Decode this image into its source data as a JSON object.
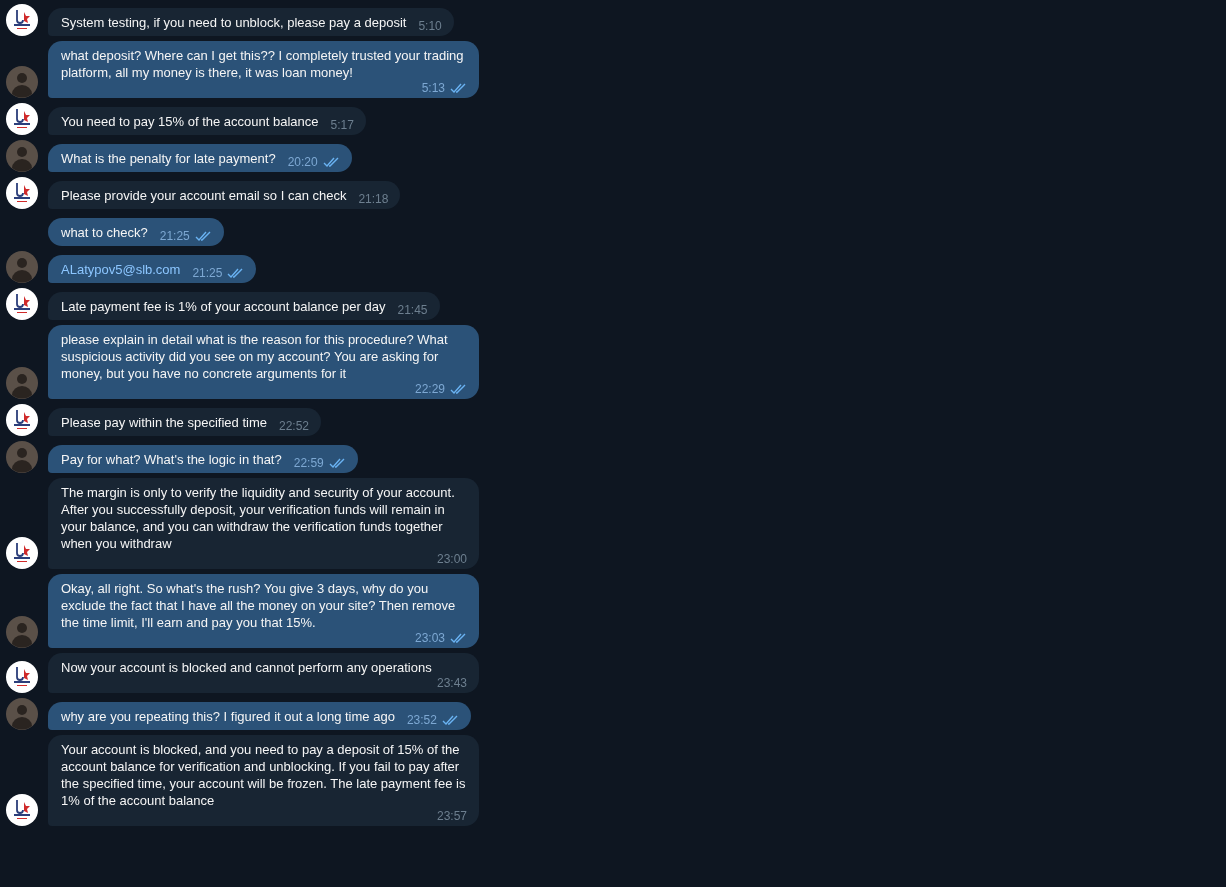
{
  "messages": [
    {
      "kind": "incoming",
      "text": "System testing, if you need to unblock, please pay a deposit",
      "time": "5:10",
      "avatar": true
    },
    {
      "kind": "outgoing",
      "text": "what deposit?  Where can I get this??  I completely trusted your trading platform, all my money is there, it was loan money!",
      "time": "5:13",
      "avatar": true,
      "read": true
    },
    {
      "kind": "incoming",
      "text": "You need to pay 15% of the account balance",
      "time": "5:17",
      "avatar": true
    },
    {
      "kind": "outgoing",
      "text": "What is the penalty for late payment?",
      "time": "20:20",
      "avatar": true,
      "read": true
    },
    {
      "kind": "incoming",
      "text": "Please provide your account email so I can check",
      "time": "21:18",
      "avatar": true
    },
    {
      "kind": "outgoing",
      "text": "what to check?",
      "time": "21:25",
      "avatar": false,
      "read": true
    },
    {
      "kind": "outgoing",
      "text": "ALatypov5@slb.com",
      "time": "21:25",
      "avatar": true,
      "read": true,
      "link": true
    },
    {
      "kind": "incoming",
      "text": "Late payment fee is 1% of your account balance per day",
      "time": "21:45",
      "avatar": true
    },
    {
      "kind": "outgoing",
      "text": "please explain in detail what is the reason for this procedure? What suspicious activity did you see on my account? You are asking for money, but you have no concrete arguments for it",
      "time": "22:29",
      "avatar": true,
      "read": true
    },
    {
      "kind": "incoming",
      "text": "Please pay within the specified time",
      "time": "22:52",
      "avatar": true
    },
    {
      "kind": "outgoing",
      "text": "Pay for what? What's the logic in that?",
      "time": "22:59",
      "avatar": true,
      "read": true
    },
    {
      "kind": "incoming",
      "text": "The margin is only to verify the liquidity and security of your account. After you successfully deposit, your verification funds will remain in your balance, and you can withdraw the verification funds together when you withdraw",
      "time": "23:00",
      "avatar": true
    },
    {
      "kind": "outgoing",
      "text": "Okay, all right. So what's the rush? You give 3 days, why do you exclude the fact that I have all the money on your site? Then remove the time limit, I'll earn and pay you that 15%.",
      "time": "23:03",
      "avatar": true,
      "read": true
    },
    {
      "kind": "incoming",
      "text": "Now your account is blocked and cannot perform any operations",
      "time": "23:43",
      "avatar": true
    },
    {
      "kind": "outgoing",
      "text": "why are you repeating this?  I figured it out a long time ago",
      "time": "23:52",
      "avatar": true,
      "read": true
    },
    {
      "kind": "incoming",
      "text": "Your account is blocked, and you need to pay a deposit of 15% of the account balance for verification and unblocking. If you fail to pay after the specified time, your account will be frozen. The late payment fee is 1% of the account balance",
      "time": "23:57",
      "avatar": true
    }
  ]
}
